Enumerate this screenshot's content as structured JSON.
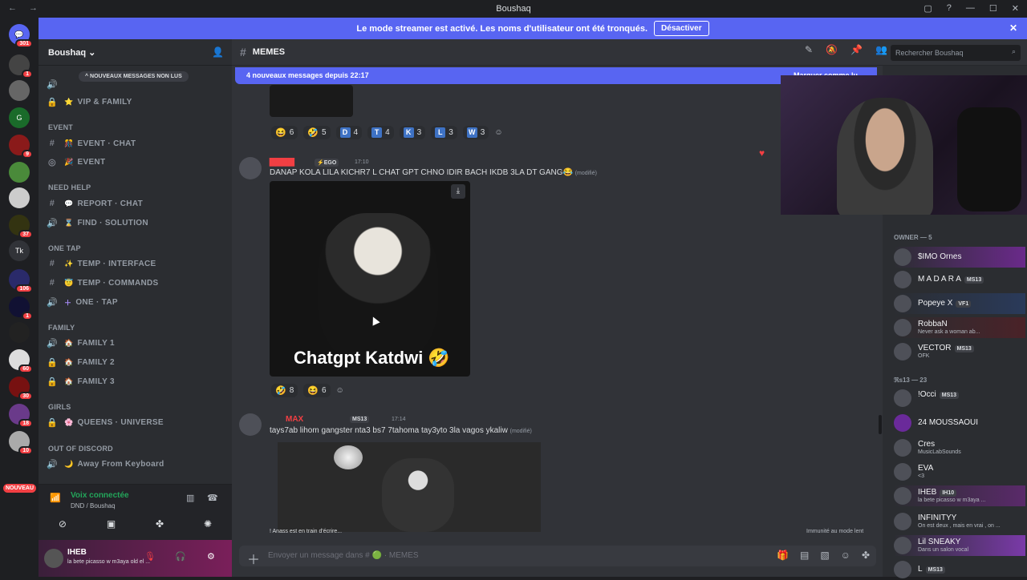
{
  "app": {
    "title": "Boushaq",
    "nav": "← →"
  },
  "banner": {
    "text": "Le mode streamer est activé. Les noms d'utilisateur ont été tronqués.",
    "button": "Désactiver",
    "close": "✕"
  },
  "guilds": {
    "badges": [
      "301",
      "1",
      "9",
      "37",
      "106",
      "1",
      "60",
      "30",
      "18",
      "10"
    ],
    "tk": "Tk",
    "new": "NOUVEAU"
  },
  "server": {
    "name": "Boushaq ⌄",
    "unread_pill": "^ NOUVEAUX MESSAGES NON LUS"
  },
  "channels": {
    "vip": "VIP & FAMILY",
    "cat_event": "EVENT",
    "event_chat": "EVENT · CHAT",
    "event": "EVENT",
    "cat_help": "NEED HELP",
    "report": "REPORT · CHAT",
    "find": "FIND · SOLUTION",
    "cat_onetap": "ONE TAP",
    "temp_interface": "TEMP · INTERFACE",
    "temp_commands": "TEMP · COMMANDS",
    "one_tap": "ONE · TAP",
    "cat_family": "FAMILY",
    "family1": "FAMILY 1",
    "family2": "FAMILY 2",
    "family3": "FAMILY 3",
    "cat_girls": "GIRLS",
    "queens": "QUEENS · UNIVERSE",
    "cat_out": "OUT OF DISCORD",
    "afk": "Away From Keyboard"
  },
  "voice": {
    "status": "Voix connectée",
    "channel": "DND / Boushaq"
  },
  "user": {
    "name": "IHEB",
    "status": "la bete picasso w m3aya old el ..."
  },
  "channel_header": {
    "name": "MEMES",
    "search": "Rechercher Boushaq"
  },
  "new_messages": {
    "text": "4 nouveaux messages depuis 22:17",
    "mark": "Marquer comme lu"
  },
  "reactions1": [
    {
      "e": "😆",
      "c": "6"
    },
    {
      "e": "🤣",
      "c": "5"
    },
    {
      "e": "D",
      "c": "4"
    },
    {
      "e": "T",
      "c": "4"
    },
    {
      "e": "K",
      "c": "3"
    },
    {
      "e": "L",
      "c": "3"
    },
    {
      "e": "W",
      "c": "3"
    }
  ],
  "msg1": {
    "tag": "⚡EGO",
    "time": "17:10",
    "text": "DANAP KOLA LILA KICHR7 L CHAT GPT  CHNO IDIR BACH IKDB 3LA DT GANG😂",
    "edited": "(modifié)",
    "caption": "Chatgpt Katdwi 🤣"
  },
  "reactions2": [
    {
      "e": "🤣",
      "c": "8"
    },
    {
      "e": "😆",
      "c": "6"
    }
  ],
  "msg2": {
    "name": "MAX",
    "tag": "MS13",
    "time": "17:14",
    "text": "tays7ab lihom  gangster  nta3  bs7  7tahoma  tay3yto  3la  vagos  ykaliw",
    "edited": "(modifié)"
  },
  "typing": {
    "text": "! Anass est en train d'écrire...",
    "slowmode": "Immunité au mode lent"
  },
  "composer": {
    "placeholder": "Envoyer un message dans # 🟢 · MEMES"
  },
  "members": {
    "cat_owner": "OWNER — 5",
    "owners": [
      {
        "n": "$IMO Ornes",
        "s": ""
      },
      {
        "n": "M A D A R A",
        "s": "",
        "t": "MS13"
      },
      {
        "n": "Popeye X",
        "s": "",
        "t": "VF1"
      },
      {
        "n": "RobbaN",
        "s": "Never ask a woman ab..."
      },
      {
        "n": "VECTOR",
        "s": "OFK",
        "t": "MS13"
      }
    ],
    "cat_ms13": "ℜs13 — 23",
    "ms13": [
      {
        "n": "!Occi",
        "s": "",
        "t": "MS13"
      },
      {
        "n": "24 MOUSSAOUI",
        "s": ""
      },
      {
        "n": "Cres",
        "s": "MusicLabSounds"
      },
      {
        "n": "EVA",
        "s": "<3"
      },
      {
        "n": "IHEB",
        "s": "la bete picasso w m3aya ...",
        "t": "IH10"
      },
      {
        "n": "INFINITYY",
        "s": "On est deux , mais en vrai , on ..."
      },
      {
        "n": "Lil SNEAKY",
        "s": "Dans un salon vocal"
      },
      {
        "n": "L",
        "s": "",
        "t": "MS13"
      }
    ]
  }
}
